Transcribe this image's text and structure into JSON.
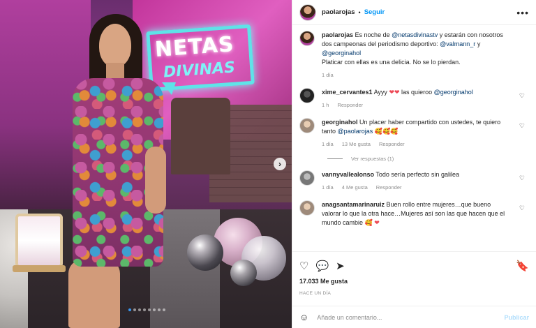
{
  "post": {
    "username": "paolarojas",
    "follow_label": "Seguir",
    "more_glyph": "•••",
    "dot": "•"
  },
  "sign": {
    "line1": "NETAS",
    "line2": "DIVINAS"
  },
  "caption": {
    "username": "paolarojas",
    "text_before": "Es noche de",
    "mention_1": "@netasdivinastv",
    "text_mid": "y estarán con nosotros dos campeonas del periodismo deportivo:",
    "mention_2": "@valmann_r",
    "text_and": "y",
    "mention_3": "@georginahol",
    "text_after": "Platicar con ellas es una delicia. No se lo pierdan.",
    "age": "1 día"
  },
  "comments": [
    {
      "username": "xime_cervantes1",
      "text_before": "Ayyy",
      "hearts": "❤❤",
      "text_mid": "las quieroo",
      "mention": "@georginahol",
      "age": "1 h",
      "reply_label": "Responder"
    },
    {
      "username": "georginahol",
      "text": "Un placer haber compartido con ustedes, te quiero tanto",
      "mention": "@paolarojas",
      "emojis": "🥰🥰🥰",
      "age": "1 día",
      "likes": "13 Me gusta",
      "reply_label": "Responder",
      "view_replies": "Ver respuestas (1)"
    },
    {
      "username": "vannyvallealonso",
      "text": "Todo sería perfecto sin galilea",
      "age": "1 día",
      "likes": "4 Me gusta",
      "reply_label": "Responder"
    },
    {
      "username": "anagsantamarinaruiz",
      "text": "Buen rollo entre mujeres…que bueno valorar lo que la otra hace…Mujeres así son las que hacen que el mundo cambie",
      "emojis": "🥰",
      "heart": "❤"
    }
  ],
  "likes_text": "17.033 Me gusta",
  "posted_when": "HACE UN DÍA",
  "add_comment": {
    "placeholder": "Añade un comentario...",
    "post_label": "Publicar"
  },
  "icons": {
    "like": "♡",
    "comment": "💬",
    "share": "➤",
    "save": "🔖",
    "emoji": "☺",
    "comment_like": "♡",
    "arrow": "›"
  },
  "colors": {
    "accent": "#0095f6",
    "mention": "#00376b",
    "muted": "#8e8e8e",
    "heart_red": "#ed4956"
  }
}
